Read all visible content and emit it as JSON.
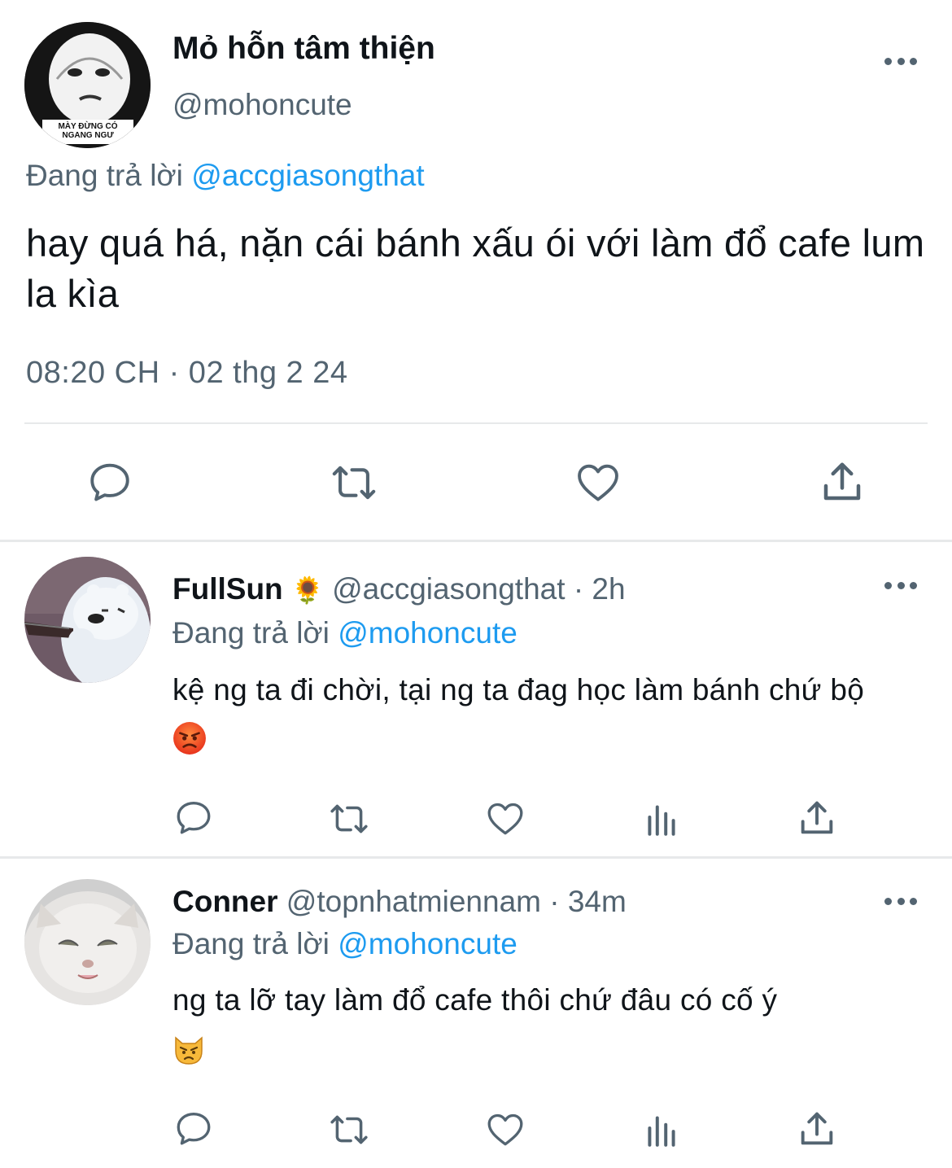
{
  "main_tweet": {
    "display_name": "Mỏ hỗn tâm thiện",
    "handle": "@mohoncute",
    "avatar_caption": "MÀY ĐỪNG CÓ NGANG NGƯ",
    "replying_prefix": "Đang trả lời",
    "replying_to": "@accgiasongthat",
    "text": "hay quá há, nặn cái bánh xấu ói với làm đổ cafe lum la kìa",
    "timestamp": "08:20 CH · 02 thg 2 24",
    "actions": [
      "reply-icon",
      "retweet-icon",
      "like-icon",
      "share-icon"
    ]
  },
  "replies": [
    {
      "display_name": "FullSun",
      "name_emoji": "🌻",
      "handle": "@accgiasongthat",
      "time": "· 2h",
      "replying_prefix": "Đang trả lời",
      "replying_to": "@mohoncute",
      "text": "kệ ng ta đi chời, tại ng ta đag học làm bánh chứ bộ",
      "text_emoji": "angry-face",
      "actions": [
        "reply-icon",
        "retweet-icon",
        "like-icon",
        "analytics-icon",
        "share-icon"
      ]
    },
    {
      "display_name": "Conner",
      "handle": "@topnhatmiennam",
      "time": "· 34m",
      "replying_prefix": "Đang trả lời",
      "replying_to": "@mohoncute",
      "text": "ng ta lỡ tay làm đổ cafe thôi chứ đâu có cố ý",
      "text_emoji": "pouting-cat-face",
      "actions": [
        "reply-icon",
        "retweet-icon",
        "like-icon",
        "analytics-icon",
        "share-icon"
      ]
    }
  ],
  "colors": {
    "text": "#0f1419",
    "secondary": "#536471",
    "mention": "#1d9bf0",
    "divider": "#e7e9ea"
  }
}
